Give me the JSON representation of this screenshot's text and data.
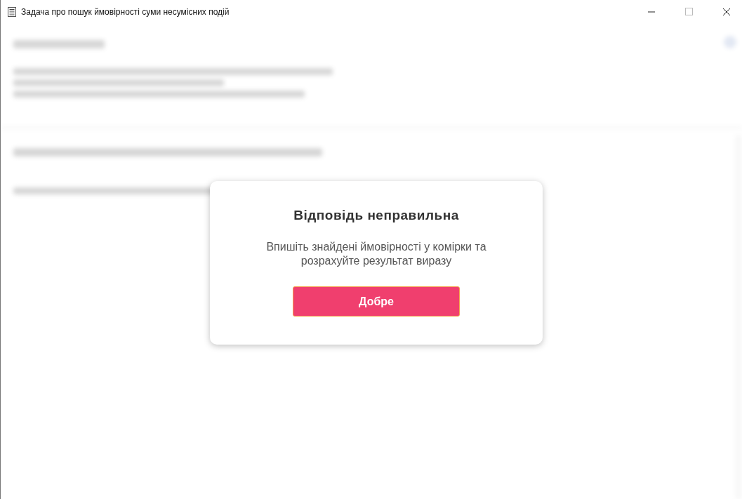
{
  "window": {
    "title": "Задача про пошук ймовірності суми несумісних подій"
  },
  "dialog": {
    "title": "Відповідь неправильна",
    "message": "Впишіть знайдені ймовірності у комірки та розрахуйте результат виразу",
    "button": "Добре"
  }
}
